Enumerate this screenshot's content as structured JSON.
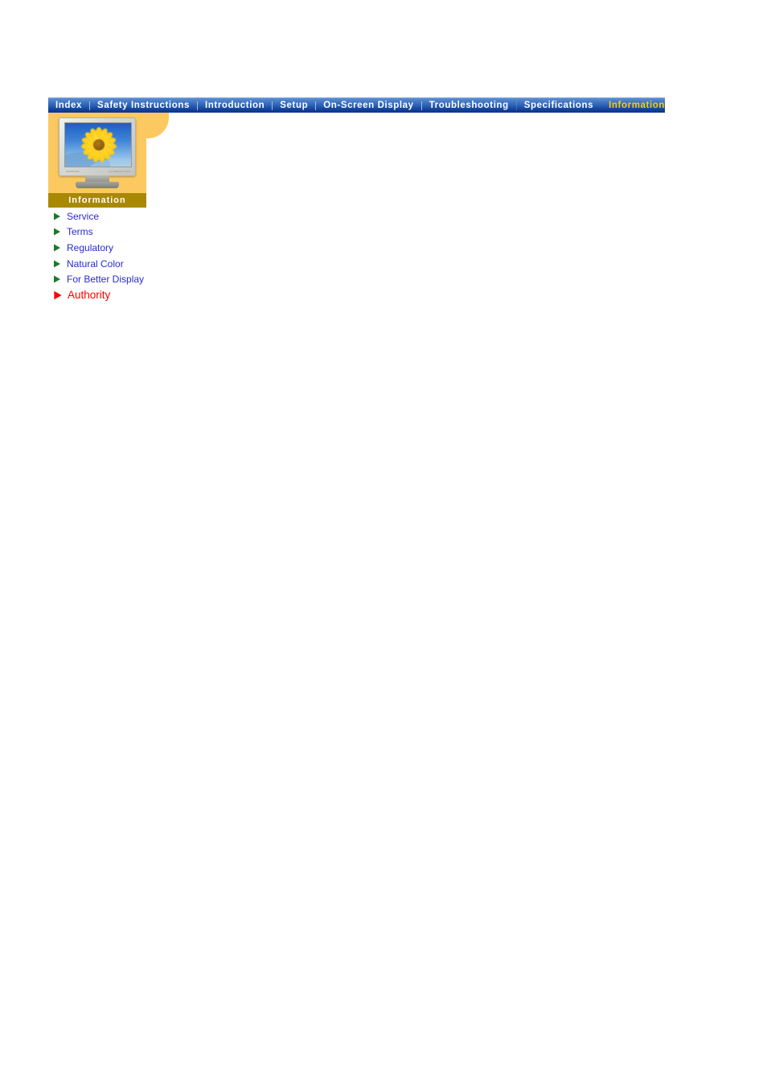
{
  "nav": {
    "items": [
      {
        "label": "Index",
        "active": false,
        "sep_after": "solid"
      },
      {
        "label": "Safety Instructions",
        "active": false,
        "sep_after": "solid"
      },
      {
        "label": "Introduction",
        "active": false,
        "sep_after": "solid"
      },
      {
        "label": "Setup",
        "active": false,
        "sep_after": "solid"
      },
      {
        "label": "On-Screen Display",
        "active": false,
        "sep_after": "solid"
      },
      {
        "label": "Troubleshooting",
        "active": false,
        "sep_after": "faint"
      },
      {
        "label": "Specifications",
        "active": false,
        "sep_after": "blank"
      },
      {
        "label": "Information",
        "active": true,
        "sep_after": "none"
      }
    ]
  },
  "panel": {
    "label": "Information",
    "thumbnail_alt": "lcd-monitor-with-sunflower-wallpaper",
    "monitor_brand_left": "SAMSUNG",
    "monitor_brand_right": "SyncMaster 172X",
    "colors": {
      "panel_gold": "#FBC95F",
      "label_gold": "#A98803",
      "nav_blue_top": "#5D8FD4",
      "nav_blue_bottom": "#0B3486",
      "nav_active_text": "#FFCC00"
    }
  },
  "links": [
    {
      "label": "Service",
      "bullet_color": "#1a7a2a",
      "text_color": "#2a2ad0",
      "highlight": false
    },
    {
      "label": "Terms",
      "bullet_color": "#1a7a2a",
      "text_color": "#2a2ad0",
      "highlight": false
    },
    {
      "label": "Regulatory",
      "bullet_color": "#1a7a2a",
      "text_color": "#2a2ad0",
      "highlight": false
    },
    {
      "label": "Natural Color",
      "bullet_color": "#1a7a2a",
      "text_color": "#2a2ad0",
      "highlight": false
    },
    {
      "label": "For Better Display",
      "bullet_color": "#1a7a2a",
      "text_color": "#2a2ad0",
      "highlight": false
    },
    {
      "label": "Authority",
      "bullet_color": "#ff0000",
      "text_color": "#ff0000",
      "highlight": true
    }
  ]
}
